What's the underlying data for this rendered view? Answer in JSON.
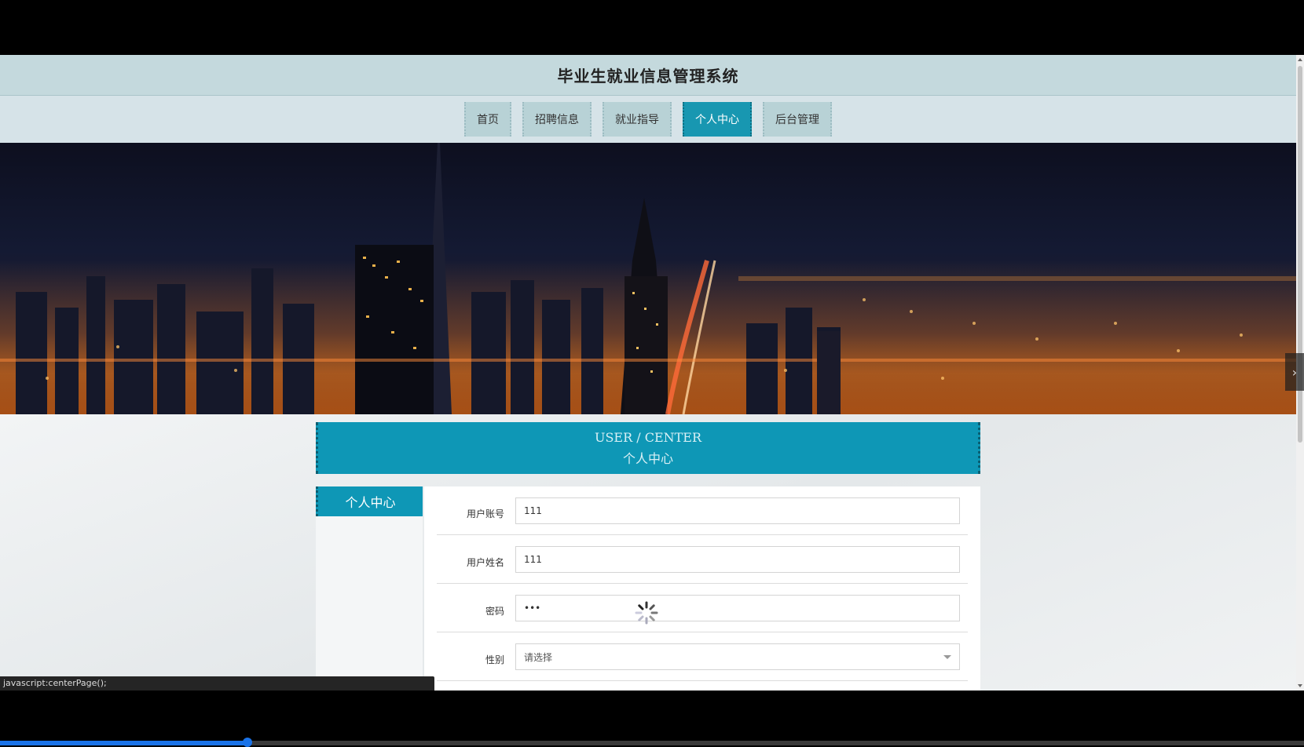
{
  "header": {
    "title": "毕业生就业信息管理系统"
  },
  "nav": {
    "items": [
      {
        "label": "首页"
      },
      {
        "label": "招聘信息"
      },
      {
        "label": "就业指导"
      },
      {
        "label": "个人中心"
      },
      {
        "label": "后台管理"
      }
    ],
    "active_index": 3
  },
  "banner": {
    "en": "USER / CENTER",
    "cn": "个人中心"
  },
  "side_panel": {
    "tab_label": "个人中心"
  },
  "form": {
    "fields": [
      {
        "label": "用户账号",
        "value": "111"
      },
      {
        "label": "用户姓名",
        "value": "111"
      },
      {
        "label": "密码",
        "value": "•••"
      },
      {
        "label": "性别",
        "value": "请选择"
      }
    ]
  },
  "status_bar": {
    "text": "javascript:centerPage();"
  },
  "video_progress": {
    "fraction": 0.19
  },
  "colors": {
    "accent": "#0e97b6",
    "header_bg": "#c4d9dd"
  }
}
